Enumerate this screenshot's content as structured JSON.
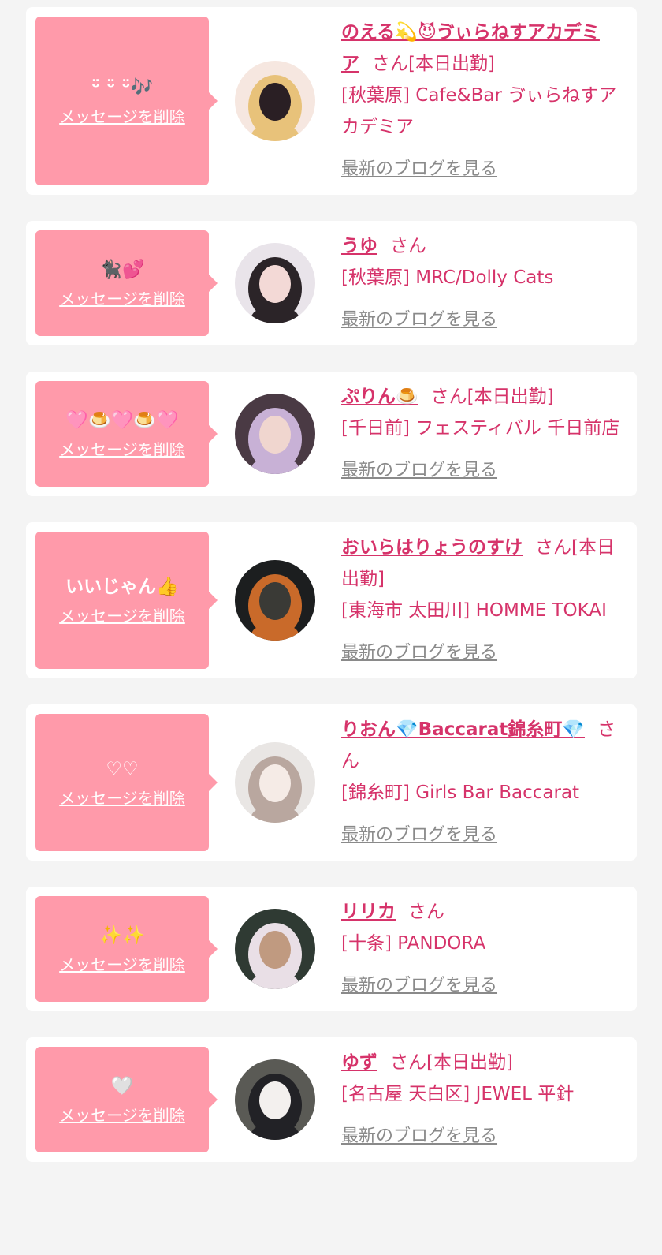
{
  "delete_label": "メッセージを削除",
  "blog_label": "最新のブログを見る",
  "colors": {
    "accent": "#d6336a",
    "bubble": "#ff9aaa",
    "link_gray": "#8a8a8a",
    "background": "#f4f4f4"
  },
  "messages": [
    {
      "bubble_text": "ᵕ̈ ᵕ̈ ᵕ̈🎶",
      "name": "のえる💫😈ゔぃらねすアカデミア",
      "suffix": "さん[本日出勤]",
      "shop": "[秋葉原] Cafe&Bar ゔぃらねすアカデミア",
      "avatar_icon": "avatar-blonde-girl"
    },
    {
      "bubble_text": "🐈‍⬛💕",
      "name": "うゆ",
      "suffix": "さん",
      "shop": "[秋葉原] MRC/Dolly Cats",
      "avatar_icon": "avatar-dark-hair-girl"
    },
    {
      "bubble_text": "🩷🍮🩷🍮🩷",
      "name": "ぷりん🍮",
      "suffix": "さん[本日出勤]",
      "shop": "[千日前] フェスティバル 千日前店",
      "avatar_icon": "avatar-lavender-hair-girl"
    },
    {
      "bubble_text": "いいじゃん👍",
      "name": "おいらはりょうのすけ",
      "suffix": "さん[本日出勤]",
      "shop": "[東海市 太田川] HOMME TOKAI",
      "avatar_icon": "avatar-hooded-person"
    },
    {
      "bubble_text": "♡♡",
      "name": "りおん💎Baccarat錦糸町💎",
      "suffix": "さん",
      "shop": "[錦糸町] Girls Bar Baccarat",
      "avatar_icon": "avatar-light-girl"
    },
    {
      "bubble_text": "✨✨",
      "name": "リリカ",
      "suffix": "さん",
      "shop": "[十条] PANDORA",
      "avatar_icon": "avatar-ears-headband-girl"
    },
    {
      "bubble_text": "🤍",
      "name": "ゆず",
      "suffix": "さん[本日出勤]",
      "shop": "[名古屋 天白区] JEWEL 平針",
      "avatar_icon": "avatar-masked-girl"
    }
  ]
}
